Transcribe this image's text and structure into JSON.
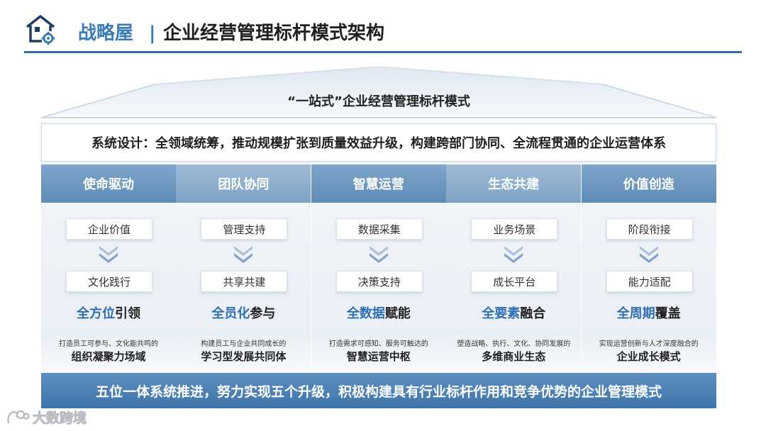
{
  "header": {
    "title_accent": "战略屋",
    "separator": "|",
    "title_main": "企业经营管理标杆模式架构",
    "accent_color": "#3a7ab8"
  },
  "roof": {
    "label": "“一站式”企业经营管理标杆模式"
  },
  "system_design": "系统设计：全领域统筹，推动规模扩张到质量效益升级，构建跨部门协同、全流程贯通的企业运营体系",
  "columns": [
    {
      "title": "使命驱动",
      "top_item": "企业价值",
      "bottom_item": "文化践行",
      "highlight_blue": "全方位",
      "highlight_rest": "引领",
      "desc_small": "打造员工可参与、文化能共鸣的",
      "desc_big": "组织凝聚力场域"
    },
    {
      "title": "团队协同",
      "top_item": "管理支持",
      "bottom_item": "共享共建",
      "highlight_blue": "全员化",
      "highlight_rest": "参与",
      "desc_small": "构建员工与企业共同成长的",
      "desc_big": "学习型发展共同体"
    },
    {
      "title": "智慧运营",
      "top_item": "数据采集",
      "bottom_item": "决策支持",
      "highlight_blue": "全数据",
      "highlight_rest": "赋能",
      "desc_small": "打造需求可感知、服务可触达的",
      "desc_big": "智慧运营中枢"
    },
    {
      "title": "生态共建",
      "top_item": "业务场景",
      "bottom_item": "成长平台",
      "highlight_blue": "全要素",
      "highlight_rest": "融合",
      "desc_small": "塑造战略、执行、文化、协同发展的",
      "desc_big": "多维商业生态"
    },
    {
      "title": "价值创造",
      "top_item": "阶段衔接",
      "bottom_item": "能力适配",
      "highlight_blue": "全周期",
      "highlight_rest": "覆盖",
      "desc_small": "实现运营创新与人才深度融合的",
      "desc_big": "企业成长模式"
    }
  ],
  "bottom_banner": "五位一体系统推进，努力实现五个升级，积极构建具有行业标杆作用和竞争优势的企业管理模式",
  "watermark": {
    "text": "大数跨境"
  }
}
